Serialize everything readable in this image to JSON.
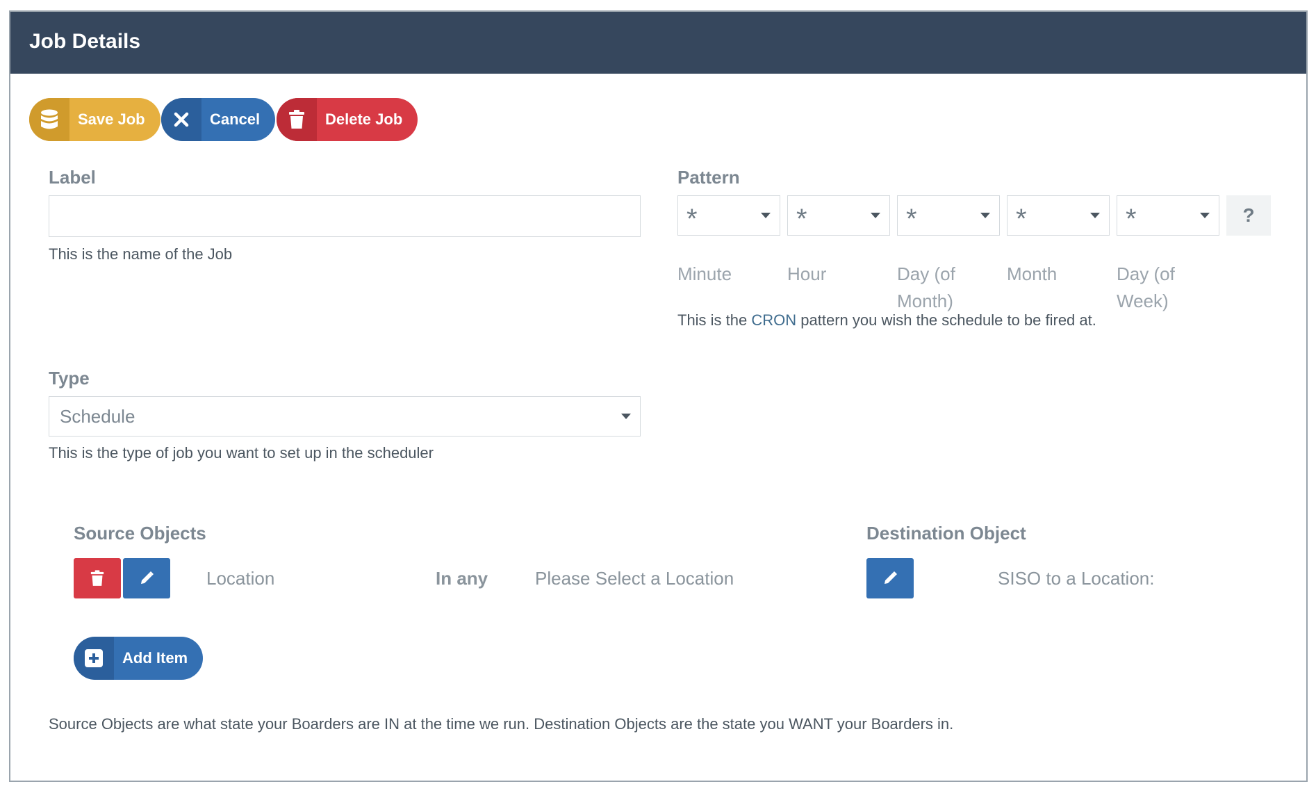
{
  "header": {
    "title": "Job Details"
  },
  "toolbar": {
    "save_label": "Save Job",
    "cancel_label": "Cancel",
    "delete_label": "Delete Job"
  },
  "label_field": {
    "label": "Label",
    "value": "",
    "help": "This is the name of the Job"
  },
  "pattern": {
    "label": "Pattern",
    "fields": [
      {
        "value": "*",
        "label": "Minute"
      },
      {
        "value": "*",
        "label": "Hour"
      },
      {
        "value": "*",
        "label": "Day (of Month)"
      },
      {
        "value": "*",
        "label": "Month"
      },
      {
        "value": "*",
        "label": "Day (of Week)"
      }
    ],
    "help_button": "?",
    "help_prefix": "This is the ",
    "help_accent": "CRON",
    "help_suffix": " pattern you wish the schedule to be fired at."
  },
  "type_field": {
    "label": "Type",
    "value": "Schedule",
    "help": "This is the type of job you want to set up in the scheduler"
  },
  "source": {
    "title": "Source Objects",
    "row": {
      "field": "Location",
      "operator": "In any",
      "value": "Please Select a Location"
    },
    "add_label": "Add Item"
  },
  "destination": {
    "title": "Destination Object",
    "value": "SISO to a Location:"
  },
  "footer_help": "Source Objects are what state your Boarders are IN at the time we run. Destination Objects are the state you WANT your Boarders in.",
  "colors": {
    "header_bg": "#36475d",
    "warning": "#e6b040",
    "info": "#3470b3",
    "danger": "#d83a45"
  },
  "icons": {
    "save": "database-icon",
    "cancel": "close-icon",
    "delete": "trash-icon",
    "edit": "pencil-icon",
    "add": "plus-square-icon"
  }
}
